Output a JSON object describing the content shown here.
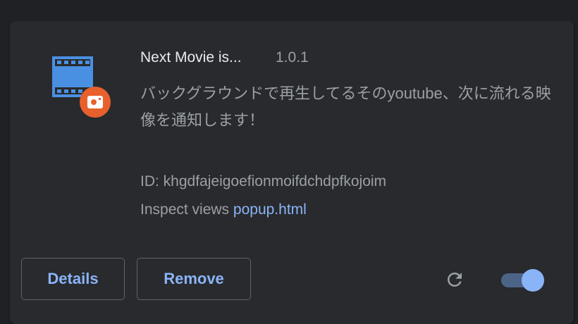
{
  "extension": {
    "name": "Next Movie is...",
    "version": "1.0.1",
    "description": "バックグラウンドで再生してるそのyoutube、次に流れる映像を通知します！",
    "id_label": "ID: khgdfajeigoefionmoifdchdpfkojoim",
    "inspect_label": "Inspect views",
    "inspect_link": "popup.html",
    "icon": "film-with-play-badge-icon"
  },
  "actions": {
    "details_label": "Details",
    "remove_label": "Remove",
    "reload_icon": "reload-icon",
    "enabled": true
  },
  "colors": {
    "background": "#202124",
    "card": "#292a2d",
    "accent": "#8ab4f8",
    "text_primary": "#e8eaed",
    "text_secondary": "#9aa0a6",
    "icon_blue": "#4a90e2",
    "badge_orange": "#e8602c"
  }
}
